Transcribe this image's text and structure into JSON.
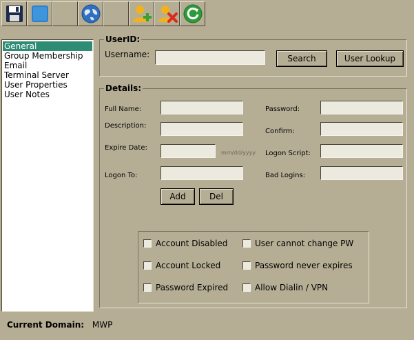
{
  "toolbar": {
    "buttons": [
      {
        "icon": "save-icon"
      },
      {
        "icon": "blank-document-icon"
      },
      {
        "icon": "empty-slot"
      },
      {
        "icon": "globe-icon"
      },
      {
        "icon": "empty-slot"
      },
      {
        "icon": "add-user-icon"
      },
      {
        "icon": "remove-user-icon"
      },
      {
        "icon": "refresh-icon"
      }
    ]
  },
  "sidebar": {
    "items": [
      {
        "label": "General",
        "selected": true
      },
      {
        "label": "Group Membership"
      },
      {
        "label": "Email"
      },
      {
        "label": "Terminal Server"
      },
      {
        "label": "User Properties"
      },
      {
        "label": "User Notes"
      }
    ]
  },
  "userid": {
    "title": "UserID:",
    "username_label": "Username:",
    "username_value": "",
    "search_label": "Search",
    "lookup_label": "User Lookup"
  },
  "details": {
    "title": "Details:",
    "full_name_label": "Full Name:",
    "description_label": "Description:",
    "expire_date_label": "Expire Date:",
    "date_format_hint": "mm/dd/yyyy",
    "logon_to_label": "Logon To:",
    "password_label": "Password:",
    "confirm_label": "Confirm:",
    "logon_script_label": "Logon Script:",
    "bad_logins_label": "Bad Logins:",
    "add_label": "Add",
    "del_label": "Del"
  },
  "checkboxes": {
    "account_disabled": "Account Disabled",
    "account_locked": "Account Locked",
    "password_expired": "Password Expired",
    "cannot_change_pw": "User cannot change PW",
    "password_never_expires": "Password never expires",
    "allow_dialin": "Allow Dialin / VPN"
  },
  "status": {
    "domain_label": "Current Domain:",
    "domain_value": "MWP"
  },
  "colors": {
    "background": "#b5ad94",
    "selection": "#2e8b74"
  }
}
